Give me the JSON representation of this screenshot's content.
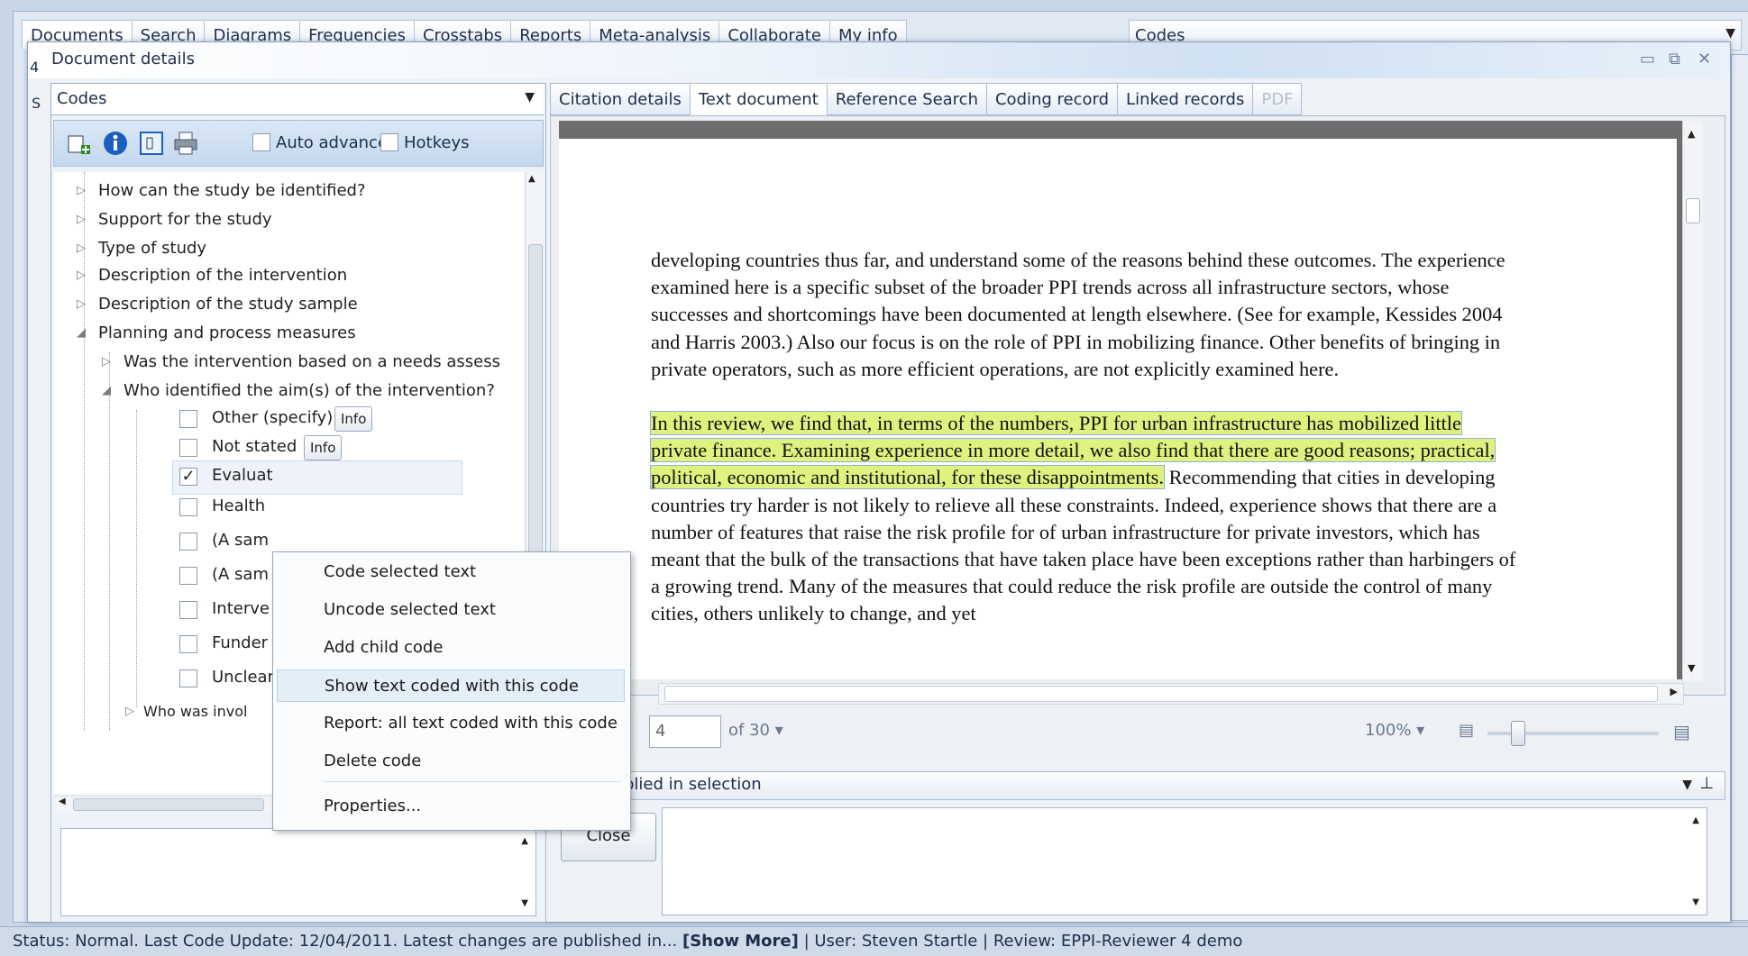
{
  "main_tabs": [
    "Documents",
    "Search",
    "Diagrams",
    "Frequencies",
    "Crosstabs",
    "Reports",
    "Meta-analysis",
    "Collaborate",
    "My info"
  ],
  "top_codes_dropdown": "Codes",
  "dialog": {
    "title": "Document details",
    "side_digit": "4",
    "side_letter": "S"
  },
  "left_pane": {
    "codes_select": "Codes",
    "auto_advance_label": "Auto advance",
    "hotkeys_label": "Hotkeys",
    "tree": [
      {
        "label": "How can the study be identified?"
      },
      {
        "label": "Support for the study"
      },
      {
        "label": "Type of study"
      },
      {
        "label": "Description of the intervention"
      },
      {
        "label": "Description of the study sample"
      },
      {
        "label": "Planning and process measures"
      },
      {
        "label": "Was the intervention based on a needs assess"
      },
      {
        "label": "Who identified the aim(s) of the intervention?"
      },
      {
        "label": "Other (specify)"
      },
      {
        "label": "Not stated"
      },
      {
        "label": "Evaluat"
      },
      {
        "label": "Health"
      },
      {
        "label": "(A sam"
      },
      {
        "label": "(A sam"
      },
      {
        "label": "Interve"
      },
      {
        "label": "Funder"
      },
      {
        "label": "Unclear"
      },
      {
        "label": "Who was invol"
      }
    ],
    "info_label": "Info"
  },
  "doc_tabs": [
    "Citation details",
    "Text document",
    "Reference Search",
    "Coding record",
    "Linked records",
    "PDF"
  ],
  "document": {
    "para1": "developing countries thus far, and understand some of the reasons behind these outcomes. The experience examined here is a specific subset of the broader PPI trends across all infrastructure sectors, whose successes and shortcomings have been documented at length elsewhere. (See for example, Kessides 2004 and Harris 2003.) Also our focus is on the role of PPI in mobilizing finance. Other benefits of bringing in private operators, such as more efficient operations, are not explicitly examined here.",
    "highlight": "In this review, we find that, in terms of the numbers, PPI for urban infrastructure has mobilized little private finance.  Examining experience in more detail, we also find that there are good reasons; practical, political, economic and institutional, for these disappointments.",
    "para2_rest": " Recommending that cities in  developing countries try harder is not likely to relieve all these constraints. Indeed, experience shows that there are a number of features that raise the risk profile for of urban infrastructure for private investors, which has meant that the bulk of the transactions that have taken place have been exceptions rather than harbingers of a growing trend. Many of the measures that could reduce the risk profile are outside the control of many  cities, others unlikely to change, and yet"
  },
  "pager": {
    "page": "4",
    "of": "of 30 ▾",
    "zoom": "100% ▾"
  },
  "applied": {
    "title": "plied in selection",
    "close_label": "Close"
  },
  "context_menu": [
    "Code selected text",
    "Uncode selected text",
    "Add child code",
    "Show text coded with this code",
    "Report: all text coded with this code",
    "Delete code",
    "Properties..."
  ],
  "status": {
    "prefix": "Status: Normal. Last Code Update: 12/04/2011. Latest changes are published in... ",
    "show_more": "[Show More]",
    "suffix": "  | User: Steven Startle | Review: EPPI-Reviewer 4 demo"
  }
}
